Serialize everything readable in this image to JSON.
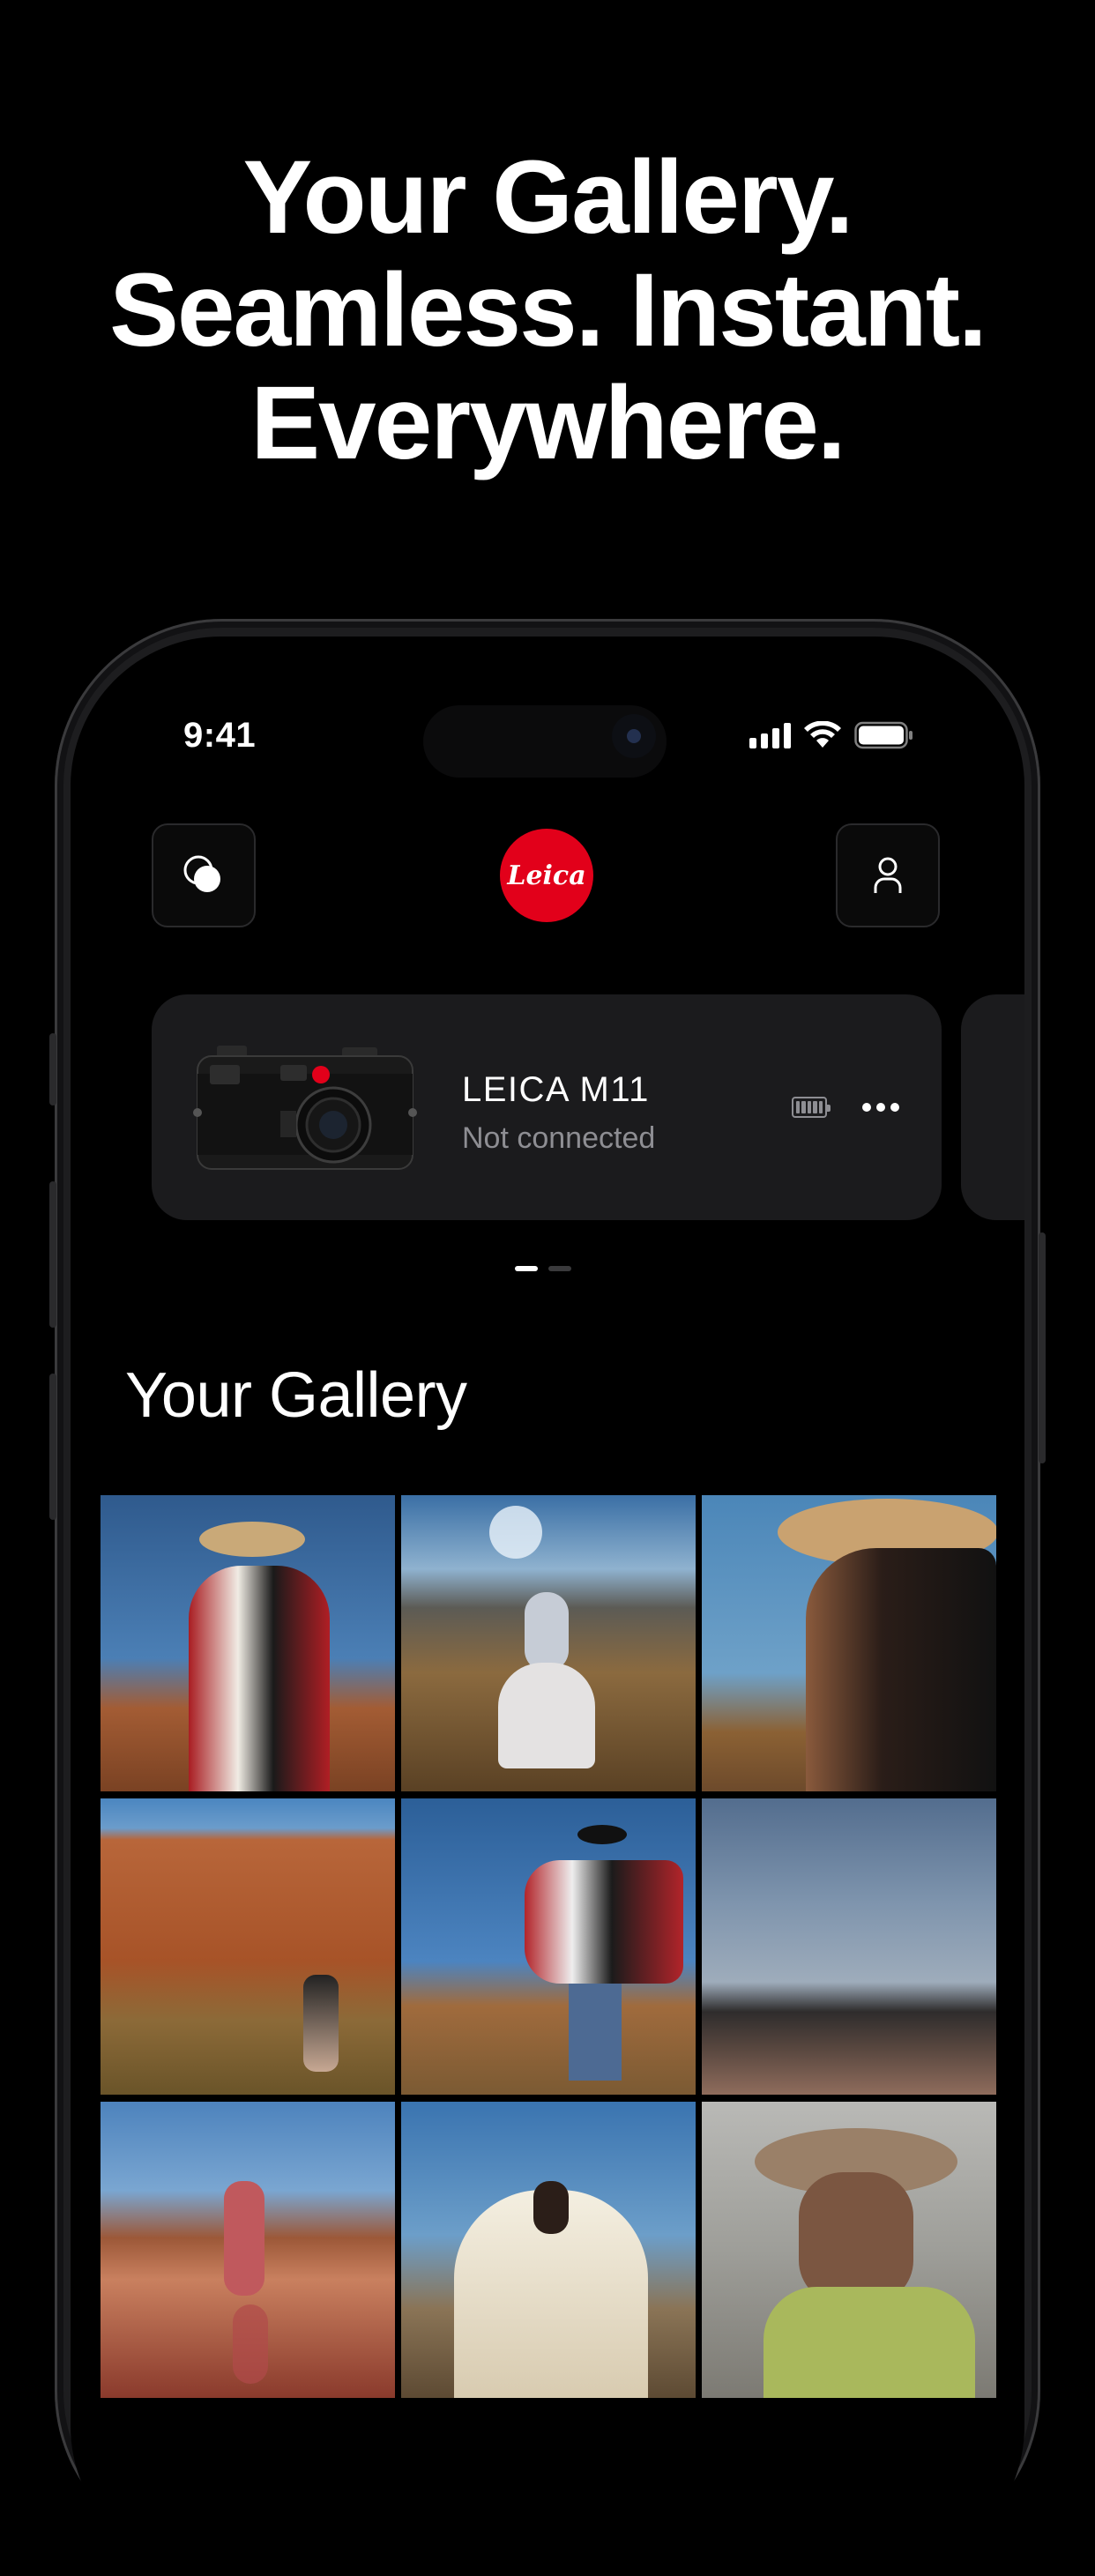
{
  "headline": {
    "line1": "Your Gallery.",
    "line2": "Seamless. Instant.",
    "line3": "Everywhere."
  },
  "status_bar": {
    "time": "9:41",
    "icons": [
      "cellular-signal-icon",
      "wifi-icon",
      "battery-icon"
    ]
  },
  "top_bar": {
    "left_button_icon": "circles-icon",
    "logo_text": "Leica",
    "right_button_icon": "person-icon",
    "brand_color": "#e2001a"
  },
  "camera_card": {
    "name": "LEICA M11",
    "status": "Not connected",
    "battery_icon": "battery-icon",
    "more_icon": "more-icon"
  },
  "pager": {
    "count": 2,
    "active": 1
  },
  "gallery": {
    "title": "Your Gallery",
    "photos": [
      "photo-woman-red-poncho-hat",
      "photo-woman-white-dress-desert",
      "photo-woman-hat-profile",
      "photo-red-butte-figure",
      "photo-dancer-poncho",
      "photo-stormy-landscape",
      "photo-dancer-reflection",
      "photo-woman-veil-spread",
      "photo-man-hat-glasses"
    ]
  }
}
